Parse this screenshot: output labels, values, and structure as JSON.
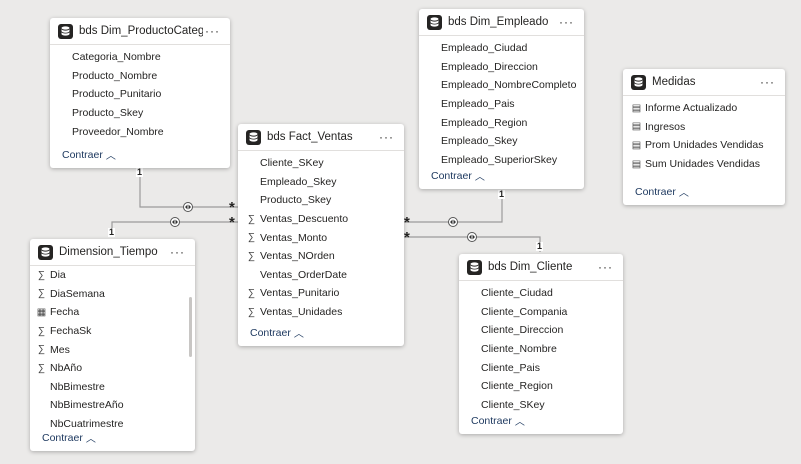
{
  "tables": {
    "producto": {
      "title": "bds Dim_ProductoCategoria",
      "fields": [
        "Categoria_Nombre",
        "Producto_Nombre",
        "Producto_Punitario",
        "Producto_Skey",
        "Proveedor_Nombre"
      ],
      "collapse": "Contraer"
    },
    "empleado": {
      "title": "bds Dim_Empleado",
      "fields": [
        "Empleado_Ciudad",
        "Empleado_Direccion",
        "Empleado_NombreCompleto",
        "Empleado_Pais",
        "Empleado_Region",
        "Empleado_Skey",
        "Empleado_SuperiorSkey"
      ],
      "collapse": "Contraer"
    },
    "medidas": {
      "title": "Medidas",
      "fields": [
        "Informe Actualizado",
        "Ingresos",
        "Prom Unidades Vendidas",
        "Sum Unidades Vendidas"
      ],
      "collapse": "Contraer"
    },
    "fact": {
      "title": "bds Fact_Ventas",
      "fields": [
        "Cliente_SKey",
        "Empleado_Skey",
        "Producto_Skey",
        "Ventas_Descuento",
        "Ventas_Monto",
        "Ventas_NOrden",
        "Ventas_OrderDate",
        "Ventas_Punitario",
        "Ventas_Unidades"
      ],
      "collapse": "Contraer"
    },
    "tiempo": {
      "title": "Dimension_Tiempo",
      "fields": [
        "Dia",
        "DiaSemana",
        "Fecha",
        "FechaSk",
        "Mes",
        "NbAño",
        "NbBimestre",
        "NbBimestreAño",
        "NbCuatrimestre"
      ],
      "collapse": "Contraer"
    },
    "cliente": {
      "title": "bds Dim_Cliente",
      "fields": [
        "Cliente_Ciudad",
        "Cliente_Compania",
        "Cliente_Direccion",
        "Cliente_Nombre",
        "Cliente_Pais",
        "Cliente_Region",
        "Cliente_SKey"
      ],
      "collapse": "Contraer"
    }
  },
  "field_icons": {
    "fact": [
      "",
      "",
      "",
      "sigma",
      "sigma",
      "sigma",
      "",
      "sigma",
      "sigma"
    ],
    "tiempo": [
      "sigma",
      "sigma",
      "calendar",
      "sigma",
      "sigma",
      "sigma",
      "",
      "",
      ""
    ],
    "medidas": [
      "measure",
      "measure",
      "measure",
      "measure"
    ]
  },
  "relationship_labels": {
    "one": "1",
    "many": "*"
  },
  "menu_label": "···",
  "colors": {
    "canvas": "#ebeae9",
    "card": "#ffffff",
    "line": "#9b9b9b",
    "collapse_text": "#1f3a60"
  }
}
